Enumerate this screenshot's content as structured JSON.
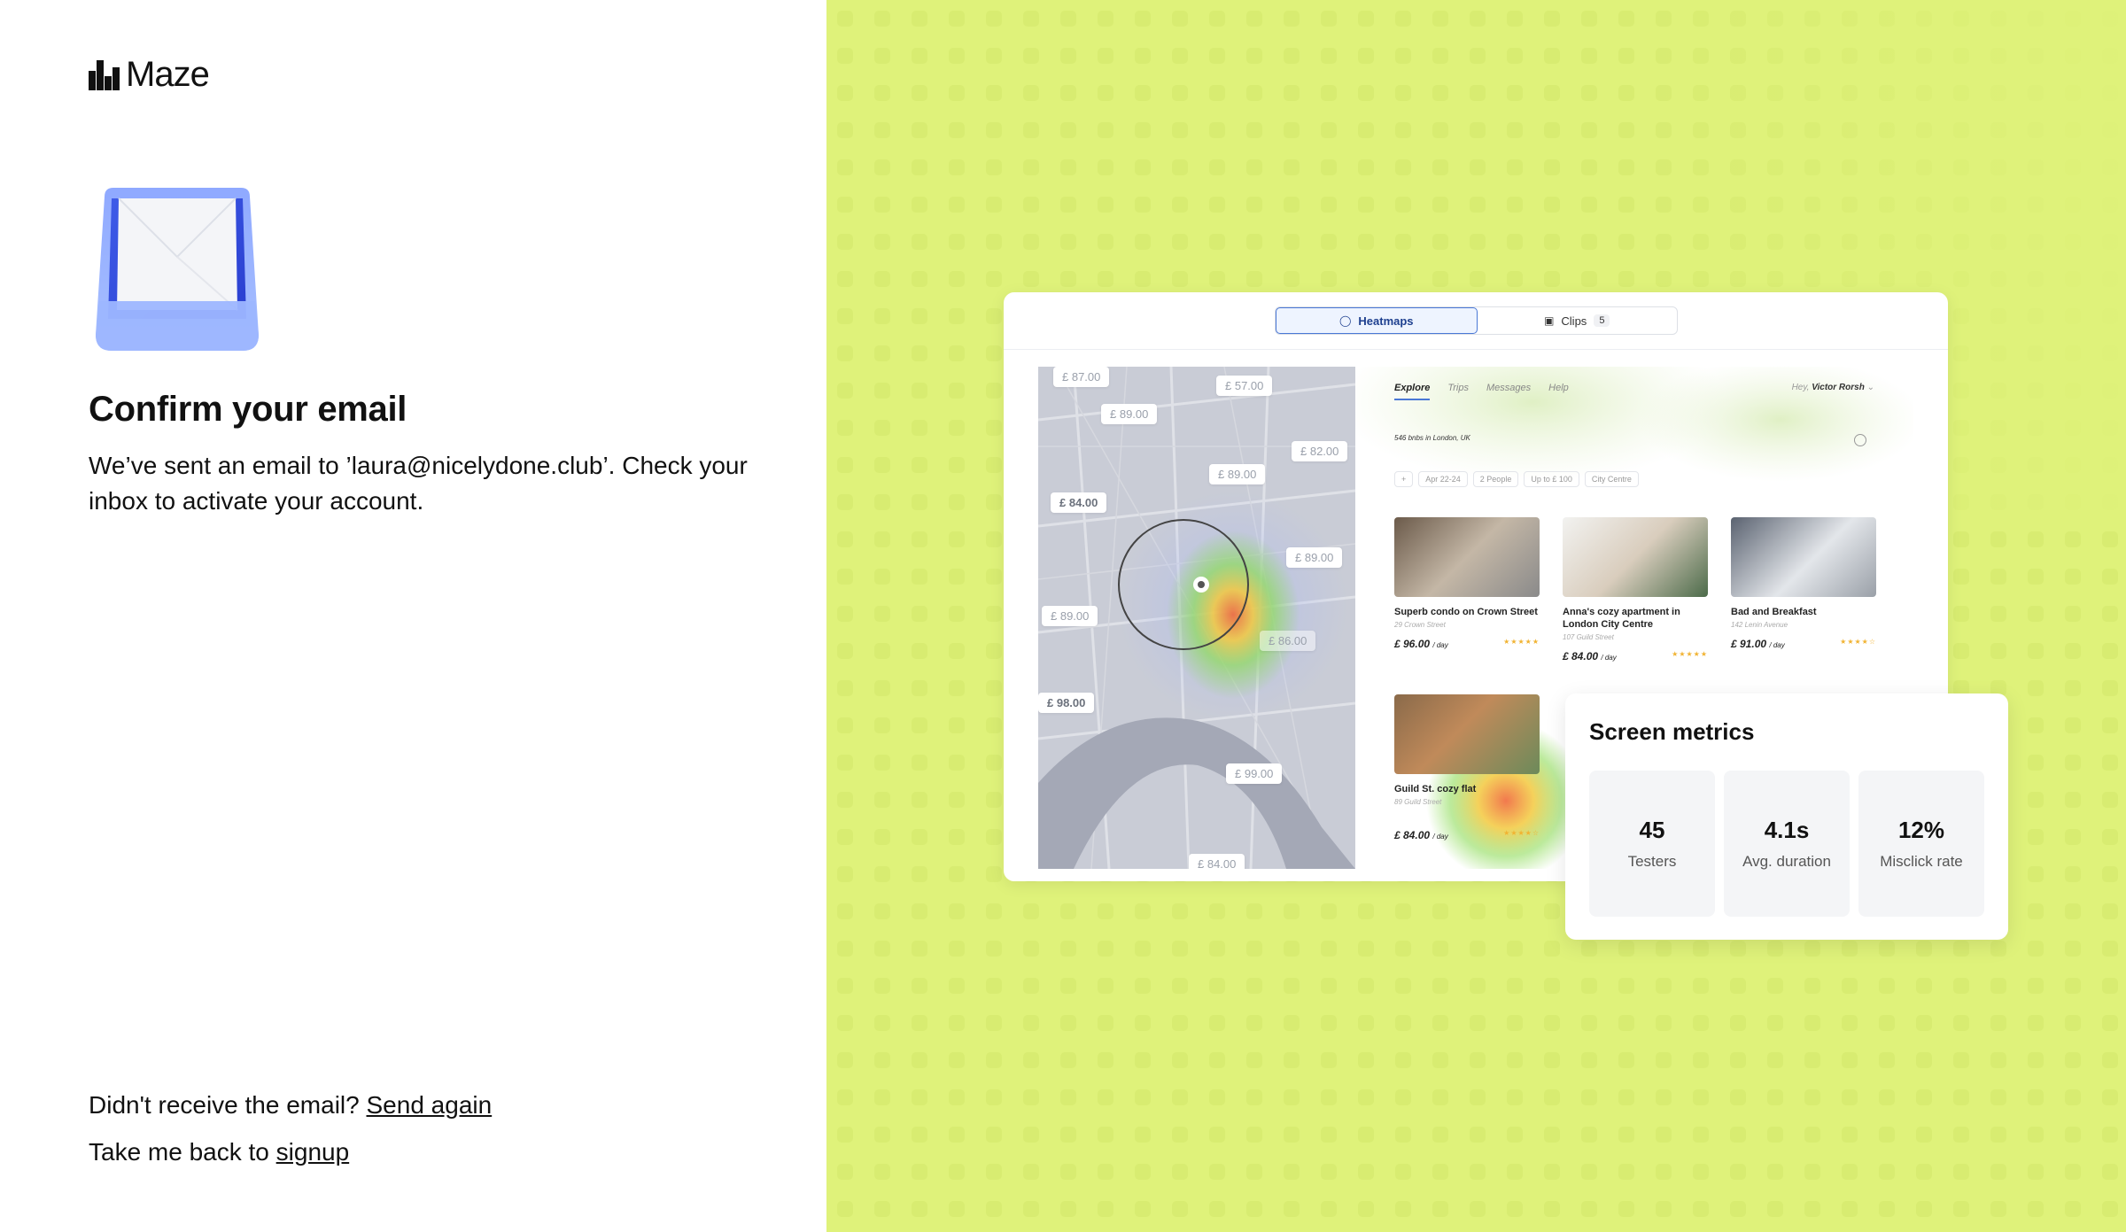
{
  "brand": {
    "name": "Maze"
  },
  "confirm": {
    "title": "Confirm your email",
    "description": "We’ve sent an email to ’laura@nicelydone.club’. Check your inbox to activate your account."
  },
  "footer": {
    "resend_prompt": "Didn't receive the email? ",
    "resend_link": "Send again",
    "back_prompt": "Take me back to ",
    "back_link": "signup"
  },
  "mockup": {
    "tabs": [
      {
        "label": "Heatmaps",
        "icon": "flame-icon",
        "active": true
      },
      {
        "label": "Clips",
        "icon": "film-icon",
        "count": "5",
        "active": false
      }
    ],
    "map_prices": [
      "£ 87.00",
      "£ 89.00",
      "£ 57.00",
      "£ 82.00",
      "£ 89.00",
      "£ 84.00",
      "£ 89.00",
      "£ 89.00",
      "£ 86.00",
      "£ 98.00",
      "£ 99.00",
      "£ 84.00"
    ],
    "nav": [
      "Explore",
      "Trips",
      "Messages",
      "Help"
    ],
    "greeting_prefix": "Hey, ",
    "greeting_name": "Victor Rorsh",
    "results": "546 bnbs in London, UK",
    "filters": [
      "+",
      "Apr 22-24",
      "2 People",
      "Up to £ 100",
      "City Centre"
    ],
    "listings": [
      {
        "title": "Superb condo on Crown Street",
        "address": "29 Crown Street",
        "price": "£ 96.00",
        "unit": "/ day"
      },
      {
        "title": "Anna's cozy apartment in London City Centre",
        "address": "107 Guild Street",
        "price": "£ 84.00",
        "unit": "/ day"
      },
      {
        "title": "Bad and Breakfast",
        "address": "142 Lenin Avenue",
        "price": "£ 91.00",
        "unit": "/ day"
      },
      {
        "title": "Guild St. cozy flat",
        "address": "89 Guild Street",
        "price": "£ 84.00",
        "unit": "/ day"
      }
    ]
  },
  "metrics": {
    "title": "Screen metrics",
    "items": [
      {
        "value": "45",
        "label": "Testers"
      },
      {
        "value": "4.1s",
        "label": "Avg. duration"
      },
      {
        "value": "12%",
        "label": "Misclick rate"
      }
    ]
  },
  "colors": {
    "panel_bg": "#dff27a",
    "accent": "#4a78d6",
    "star": "#f1b332"
  }
}
